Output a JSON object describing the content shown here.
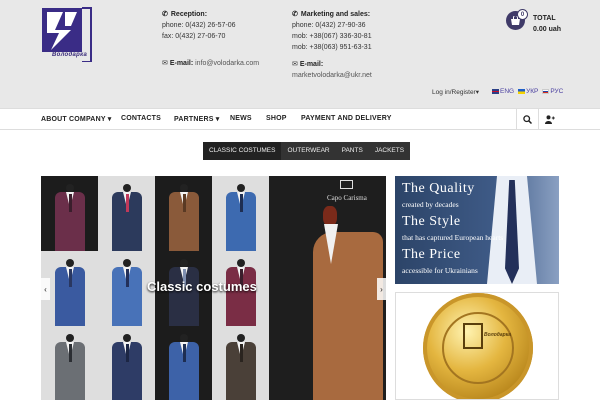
{
  "header": {
    "logo_text": "Володарка",
    "reception": {
      "title": "Reception:",
      "phone": "phone: 0(432) 26-57-06",
      "fax": "fax: 0(432) 27-06-70",
      "email_label": "E-mail:",
      "email": "info@volodarka.com"
    },
    "marketing": {
      "title": "Marketing and sales:",
      "phone": "phone: 0(432) 27-90-36",
      "mob1": "mob: +38(067) 336-30-81",
      "mob2": "mob: +38(063) 951-63-31",
      "email_label": "E-mail:",
      "email": "marketvolodarka@ukr.net"
    },
    "cart": {
      "count": "0",
      "total_label": "TOTAL",
      "total_value": "0.00 uah"
    },
    "login_label": "Log in/Register",
    "languages": [
      {
        "label": "ENG",
        "flag": "en"
      },
      {
        "label": "УКР",
        "flag": "ua"
      },
      {
        "label": "РУС",
        "flag": "ru"
      }
    ]
  },
  "nav": {
    "items": [
      {
        "label": "ABOUT COMPANY",
        "dropdown": true
      },
      {
        "label": "CONTACTS",
        "dropdown": false
      },
      {
        "label": "PARTNERS",
        "dropdown": true
      },
      {
        "label": "NEWS",
        "dropdown": false
      },
      {
        "label": "SHOP",
        "dropdown": false
      },
      {
        "label": "PAYMENT AND DELIVERY",
        "dropdown": false
      }
    ],
    "search_icon": "search-icon",
    "user_icon": "user-add-icon"
  },
  "categories": [
    "CLASSIC COSTUMES",
    "OUTERWEAR",
    "PANTS",
    "JACKETS"
  ],
  "slider": {
    "title": "Classic costumes",
    "brand": "Capo Carisma"
  },
  "banner_quality": {
    "line1": "The Quality",
    "line2": "created by decades",
    "line3": "The Style",
    "line4": "that has captured European hearts",
    "line5": "The Price",
    "line6": "accessible for Ukrainians"
  },
  "banner_coin": {
    "text": "Володарка"
  },
  "colors": {
    "accent": "#3f3a68",
    "header_bg": "#e8e8e8",
    "category_bar": "#333333"
  }
}
